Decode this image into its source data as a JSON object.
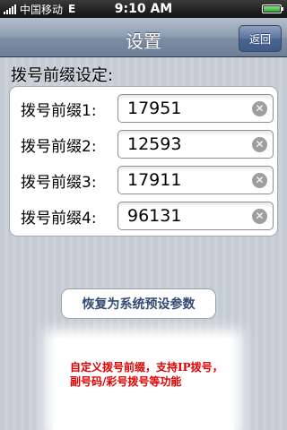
{
  "status_bar": {
    "carrier": "中国移动",
    "network": "E",
    "time": "9:10 AM"
  },
  "nav": {
    "title": "设置",
    "back_label": "返回"
  },
  "section": {
    "title": "拨号前缀设定:"
  },
  "prefixes": [
    {
      "label": "拨号前缀1:",
      "value": "17951"
    },
    {
      "label": "拨号前缀2:",
      "value": "12593"
    },
    {
      "label": "拨号前缀3:",
      "value": "17911"
    },
    {
      "label": "拨号前缀4:",
      "value": "96131"
    }
  ],
  "reset_button": {
    "label": "恢复为系统预设参数"
  },
  "promo": {
    "text": "自定义拨号前缀，支持IP拨号，副号码/彩号拨号等功能"
  },
  "icons": {
    "clear": "clear-circle-icon"
  }
}
